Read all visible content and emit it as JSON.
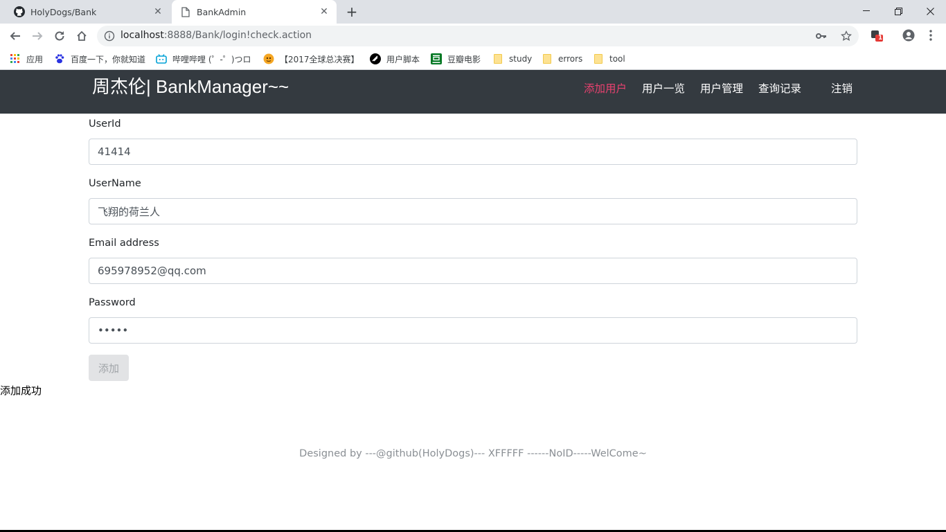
{
  "browser": {
    "tabs": [
      {
        "title": "HolyDogs/Bank",
        "active": false
      },
      {
        "title": "BankAdmin",
        "active": true
      }
    ],
    "address": {
      "host": "localhost",
      "path": ":8888/Bank/login!check.action"
    },
    "extension_badge": "1",
    "bookmarks": [
      {
        "label": "应用",
        "icon": "apps-grid-icon"
      },
      {
        "label": "百度一下，你就知道",
        "icon": "baidu-paw-icon"
      },
      {
        "label": "哔哩哔哩 (゜-゜)つロ",
        "icon": "bilibili-tv-icon"
      },
      {
        "label": "【2017全球总决赛】",
        "icon": "lol-icon"
      },
      {
        "label": "用户脚本",
        "icon": "userscript-icon"
      },
      {
        "label": "豆瓣电影",
        "icon": "douban-icon"
      },
      {
        "label": "study",
        "icon": "folder-icon"
      },
      {
        "label": "errors",
        "icon": "folder-icon"
      },
      {
        "label": "tool",
        "icon": "folder-icon"
      }
    ]
  },
  "navbar": {
    "brand": "周杰伦| BankManager~~",
    "links": [
      "添加用户",
      "用户一览",
      "用户管理",
      "查询记录"
    ],
    "logout": "注销",
    "active_color": "#e8416f"
  },
  "form": {
    "userid_label": "UserId",
    "userid_value": "41414",
    "username_label": "UserName",
    "username_value": "飞翔的荷兰人",
    "email_label": "Email address",
    "email_value": "695978952@qq.com",
    "password_label": "Password",
    "password_value": "•••••",
    "submit_label": "添加"
  },
  "message": "添加成功",
  "footer": "Designed by ---@github(HolyDogs)--- XFFFFF ------NoID-----WelCome~"
}
